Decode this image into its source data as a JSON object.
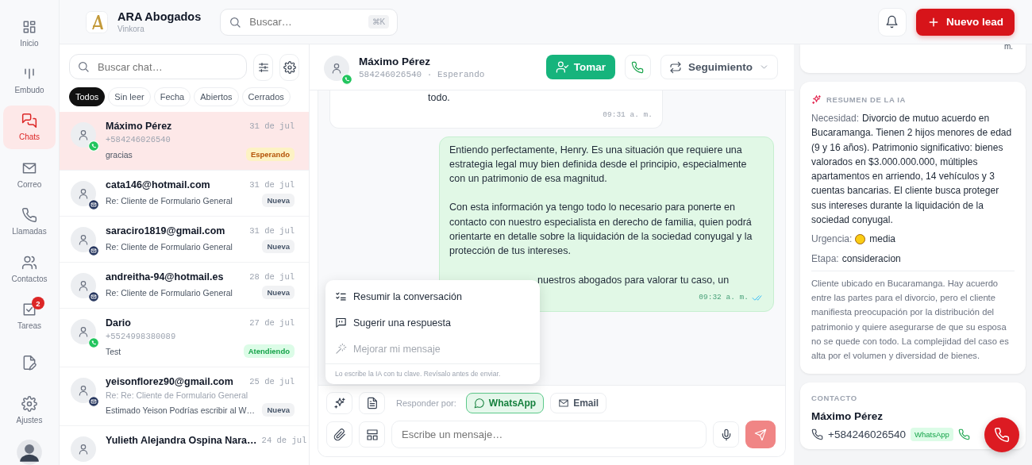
{
  "sidebar": {
    "items": [
      {
        "label": "Inicio",
        "selected": false
      },
      {
        "label": "Embudo",
        "selected": false
      },
      {
        "label": "Chats",
        "selected": true
      },
      {
        "label": "Correo",
        "selected": false
      },
      {
        "label": "Llamadas",
        "selected": false
      },
      {
        "label": "Contactos",
        "selected": false
      },
      {
        "label": "Tareas",
        "selected": false,
        "badge": "2"
      },
      {
        "selected": false
      },
      {
        "label": "Ajustes",
        "selected": false
      }
    ]
  },
  "header": {
    "brand": "ARA Abogados",
    "workspace": "Vinkora",
    "search": {
      "placeholder": "Buscar…",
      "shortcut": "⌘K"
    },
    "new_button": "Nuevo lead"
  },
  "chat_list": {
    "search": {
      "placeholder": "Buscar chat…"
    },
    "filters": [
      {
        "label": "Todos",
        "selected": true
      },
      {
        "label": "Sin leer",
        "selected": false
      },
      {
        "label": "Fecha",
        "selected": false
      },
      {
        "label": "Abiertos",
        "selected": false
      },
      {
        "label": "Cerrados",
        "selected": false
      }
    ],
    "chats": [
      {
        "name": "Máximo Pérez",
        "date": "31 de jul",
        "subtitle": "+584246026540",
        "preview": "gracias",
        "status": {
          "label": "Esperando",
          "kind": "waiting"
        },
        "kind": "whatsapp",
        "selected": true
      },
      {
        "name": "cata146@hotmail.com",
        "date": "31 de jul",
        "preview": "Re: Cliente de Formulario General",
        "status": {
          "label": "Nueva",
          "kind": "new"
        },
        "kind": "email",
        "selected": false
      },
      {
        "name": "saraciro1819@gmail.com",
        "date": "31 de jul",
        "preview": "Re: Cliente de Formulario General",
        "status": {
          "label": "Nueva",
          "kind": "new"
        },
        "kind": "email",
        "selected": false
      },
      {
        "name": "andreitha-94@hotmail.es",
        "date": "28 de jul",
        "preview": "Re: Cliente de Formulario General",
        "status": {
          "label": "Nueva",
          "kind": "new"
        },
        "kind": "email",
        "selected": false
      },
      {
        "name": "Dario",
        "date": "27 de jul",
        "subtitle": "+5524998380089",
        "preview": "Test",
        "status": {
          "label": "Atendiendo",
          "kind": "attending"
        },
        "kind": "whatsapp",
        "selected": false
      },
      {
        "name": "yeisonflorez90@gmail.com",
        "date": "25 de jul",
        "subtitle": "Re: Re: Cliente de Formulario General",
        "preview": "Estimado Yeison Podrías escribir al W…",
        "status": {
          "label": "Nueva",
          "kind": "new"
        },
        "kind": "email",
        "selected": false
      },
      {
        "name": "Yulieth Alejandra Ospina Nara…",
        "date": "24 de jul",
        "selected": false
      }
    ]
  },
  "conversation": {
    "contact": {
      "name": "Máximo Pérez",
      "sub": "584246026540 · Esperando"
    },
    "take_button": "Tomar",
    "status_menu": "Seguimiento",
    "messages": [
      {
        "kind": "in",
        "paragraphs": [
          "todo."
        ],
        "time": "09:31 a. m."
      },
      {
        "kind": "out",
        "paragraphs": [
          "Entiendo perfectamente, Henry. Es una situación que requiere una estrategia legal muy bien definida desde el principio, especialmente con un patrimonio de esa magnitud.",
          "Con esta información ya tengo todo lo necesario para ponerte en contacto con nuestro especialista en derecho de familia, quien podrá orientarte en detalle sobre la liquidación de la sociedad conyugal y la protección de tus intereses.",
          "nuestros abogados para valorar tu caso, un"
        ],
        "time": "09:32 a. m.",
        "read": true
      }
    ],
    "ai_menu": {
      "items": [
        {
          "label": "Resumir la conversación",
          "disabled": false
        },
        {
          "label": "Sugerir una respuesta",
          "disabled": false
        },
        {
          "label": "Mejorar mi mensaje",
          "disabled": true
        }
      ],
      "note": "Lo escribe la IA con tu clave. Revísalo antes de enviar."
    },
    "composer": {
      "reply_label": "Responder por:",
      "channels": [
        {
          "label": "WhatsApp",
          "selected": true
        },
        {
          "label": "Email",
          "selected": false
        }
      ],
      "placeholder": "Escribe un mensaje…"
    }
  },
  "details": {
    "prev_card_tail": "m.",
    "ai_summary": {
      "title": "RESUMEN DE LA IA",
      "fields": [
        {
          "label": "Necesidad:",
          "value": "Divorcio de mutuo acuerdo en Bucaramanga. Tienen 2 hijos menores de edad (9 y 16 años). Patrimonio significativo: bienes valorados en $3.000.000.000, múltiples apartamentos en arriendo, 14 vehículos y 3 cuentas bancarias. El cliente busca proteger sus intereses durante la liquidación de la sociedad conyugal."
        },
        {
          "label": "Urgencia:",
          "value": "media",
          "kind": "urgency"
        },
        {
          "label": "Etapa:",
          "value": "consideracion"
        }
      ],
      "notes": "Cliente ubicado en Bucaramanga. Hay acuerdo entre las partes para el divorcio, pero el cliente manifiesta preocupación por la distribución del patrimonio y quiere asegurarse de que su esposa no se quede con todo. La complejidad del caso es alta por el volumen y diversidad de bienes."
    },
    "contact": {
      "title": "CONTACTO",
      "name": "Máximo Pérez",
      "phone": "+584246026540",
      "channel_tag": "WhatsApp"
    }
  }
}
